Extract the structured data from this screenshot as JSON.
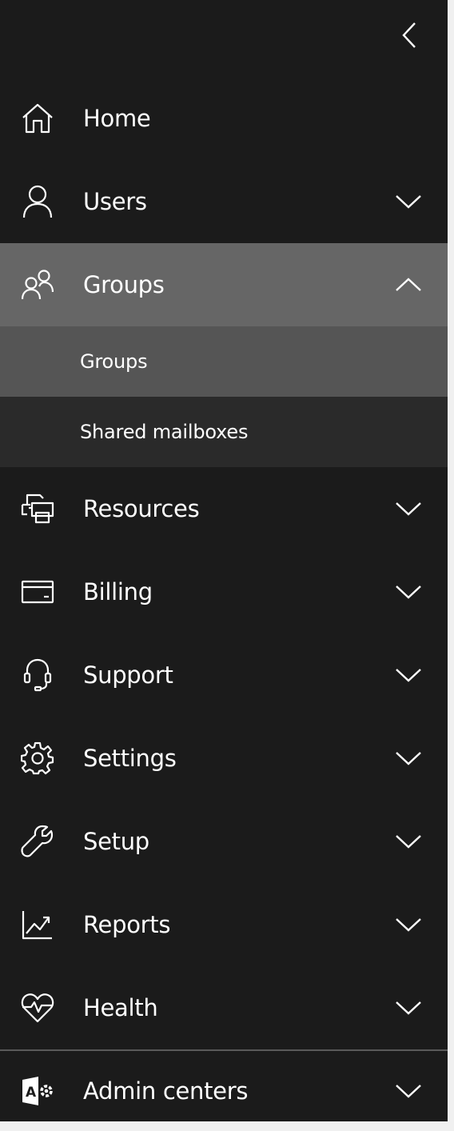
{
  "nav": {
    "collapse_icon": "chevron-left-icon",
    "items": [
      {
        "label": "Home",
        "icon": "home-icon",
        "has_chevron": false
      },
      {
        "label": "Users",
        "icon": "user-icon",
        "chevron": "chevron-down-icon"
      },
      {
        "label": "Groups",
        "icon": "groups-icon",
        "chevron": "chevron-up-icon",
        "expanded": true,
        "subitems": [
          {
            "label": "Groups",
            "selected": true
          },
          {
            "label": "Shared mailboxes",
            "selected": false
          }
        ]
      },
      {
        "label": "Resources",
        "icon": "printer-icon",
        "chevron": "chevron-down-icon"
      },
      {
        "label": "Billing",
        "icon": "credit-card-icon",
        "chevron": "chevron-down-icon"
      },
      {
        "label": "Support",
        "icon": "headset-icon",
        "chevron": "chevron-down-icon"
      },
      {
        "label": "Settings",
        "icon": "gear-icon",
        "chevron": "chevron-down-icon"
      },
      {
        "label": "Setup",
        "icon": "wrench-icon",
        "chevron": "chevron-down-icon"
      },
      {
        "label": "Reports",
        "icon": "chart-icon",
        "chevron": "chevron-down-icon"
      },
      {
        "label": "Health",
        "icon": "heart-pulse-icon",
        "chevron": "chevron-down-icon"
      },
      {
        "label": "Admin centers",
        "icon": "admin-centers-icon",
        "chevron": "chevron-down-icon"
      }
    ]
  },
  "colors": {
    "nav_bg": "#1b1b1b",
    "expanded_bg": "#666666",
    "selected_sub_bg": "#555555",
    "sub_bg": "#2a2a2a",
    "text": "#ffffff"
  }
}
